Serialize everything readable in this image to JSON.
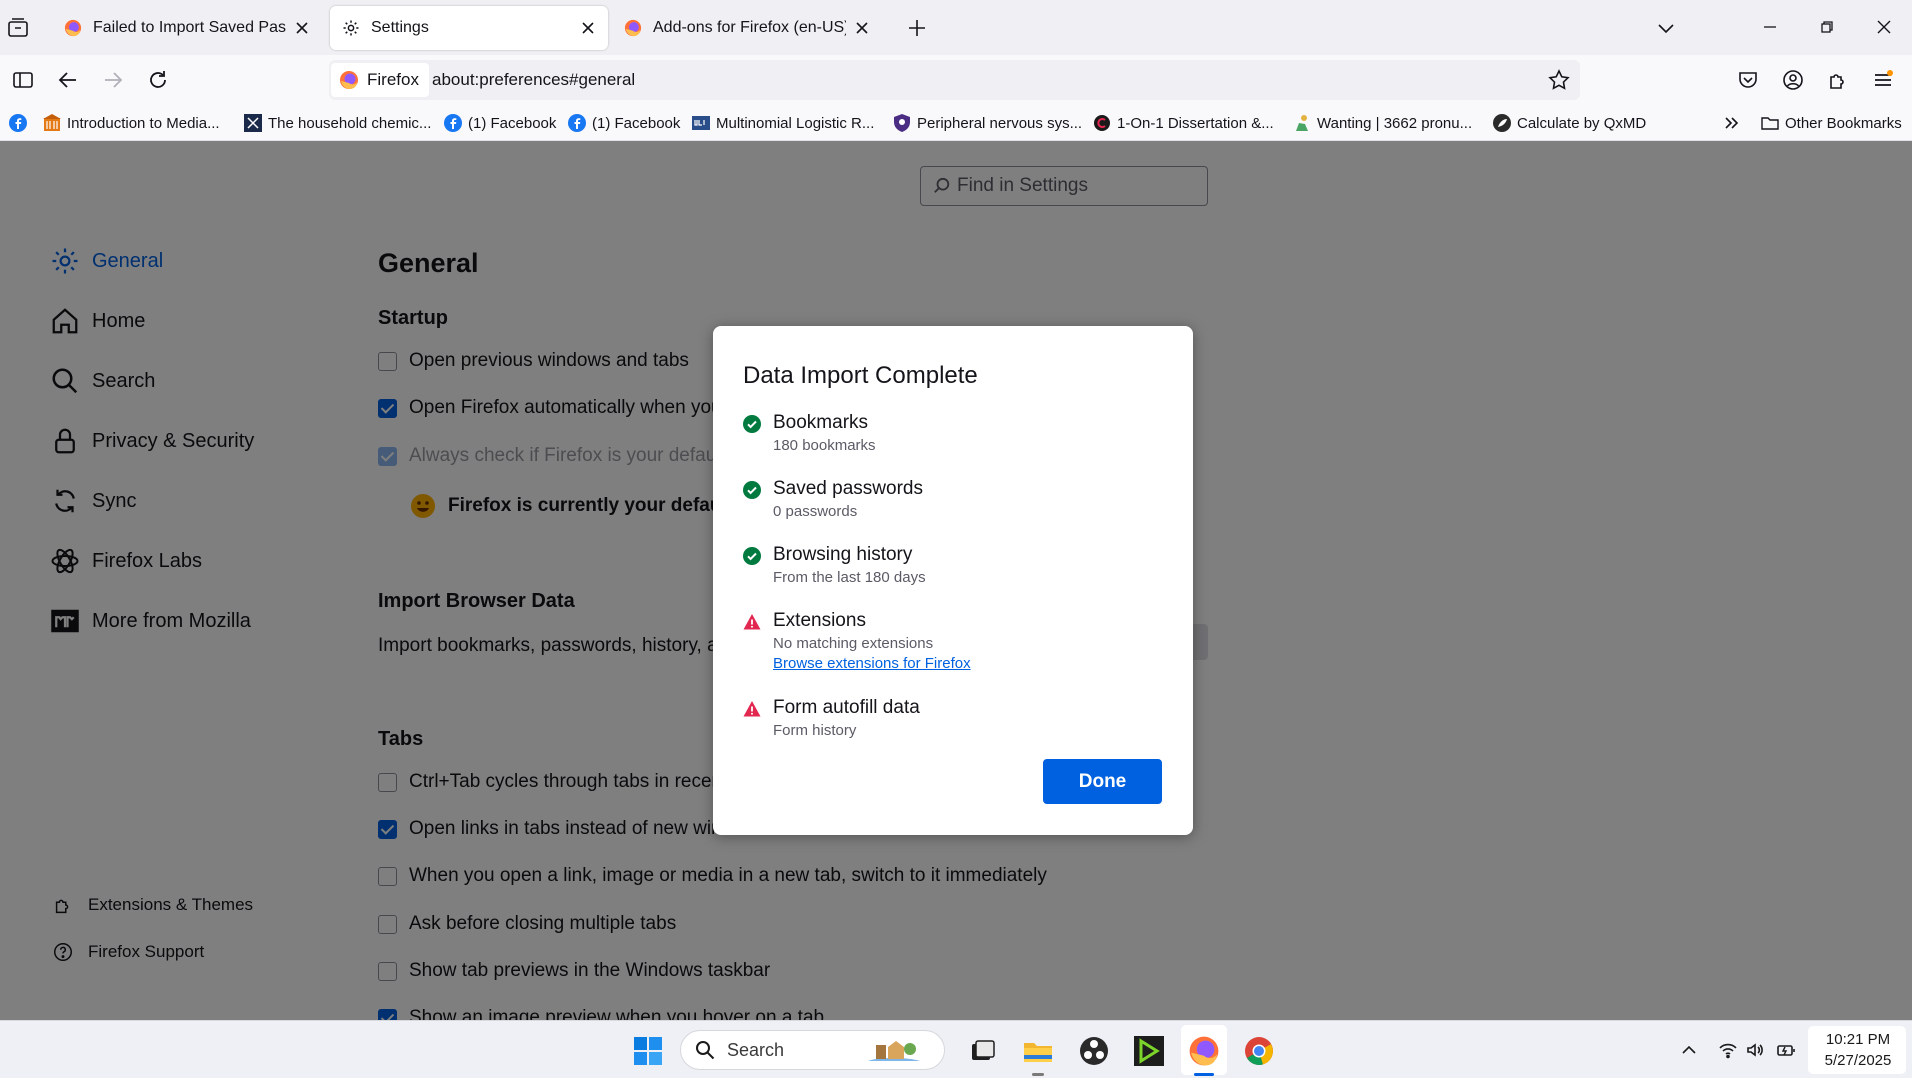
{
  "tabs": [
    {
      "title": "Failed to Import Saved Passwor",
      "active": false
    },
    {
      "title": "Settings",
      "active": true
    },
    {
      "title": "Add-ons for Firefox (en-US)",
      "active": false
    }
  ],
  "navbar": {
    "identity_label": "Firefox",
    "url": "about:preferences#general"
  },
  "bookmarks": {
    "items": [
      "",
      "Introduction to Media...",
      "The household chemic...",
      "(1) Facebook",
      "(1) Facebook",
      "Multinomial Logistic R...",
      "Peripheral nervous sys...",
      "1-On-1 Dissertation &...",
      "Wanting | 3662 pronu...",
      "Calculate by QxMD"
    ],
    "other": "Other Bookmarks"
  },
  "settings": {
    "find_placeholder": "Find in Settings",
    "categories": [
      "General",
      "Home",
      "Search",
      "Privacy & Security",
      "Sync",
      "Firefox Labs",
      "More from Mozilla"
    ],
    "footer_links": [
      "Extensions & Themes",
      "Firefox Support"
    ],
    "page_title": "General",
    "startup_title": "Startup",
    "startup_options": [
      "Open previous windows and tabs",
      "Open Firefox automatically when you",
      "Always check if Firefox is your default"
    ],
    "default_msg": "Firefox is currently your default",
    "import_title": "Import Browser Data",
    "import_desc": "Import bookmarks, passwords, history, a",
    "tabs_title": "Tabs",
    "tabs_options": [
      "Ctrl+Tab cycles through tabs in recen",
      "Open links in tabs instead of new windows",
      "When you open a link, image or media in a new tab, switch to it immediately",
      "Ask before closing multiple tabs",
      "Show tab previews in the Windows taskbar",
      "Show an image preview when you hover on a tab"
    ]
  },
  "dialog": {
    "title": "Data Import Complete",
    "items": [
      {
        "name": "Bookmarks",
        "detail": "180 bookmarks",
        "status": "success"
      },
      {
        "name": "Saved passwords",
        "detail": "0 passwords",
        "status": "success"
      },
      {
        "name": "Browsing history",
        "detail": "From the last 180 days",
        "status": "success"
      },
      {
        "name": "Extensions",
        "detail": "No matching extensions",
        "status": "warning",
        "link": "Browse extensions for Firefox"
      },
      {
        "name": "Form autofill data",
        "detail": "Form history",
        "status": "warning"
      }
    ],
    "done_label": "Done"
  },
  "taskbar": {
    "search_label": "Search",
    "time": "10:21 PM",
    "date": "5/27/2025"
  },
  "colors": {
    "accent": "#0061e0",
    "success": "#017a40",
    "warning": "#e22850"
  }
}
